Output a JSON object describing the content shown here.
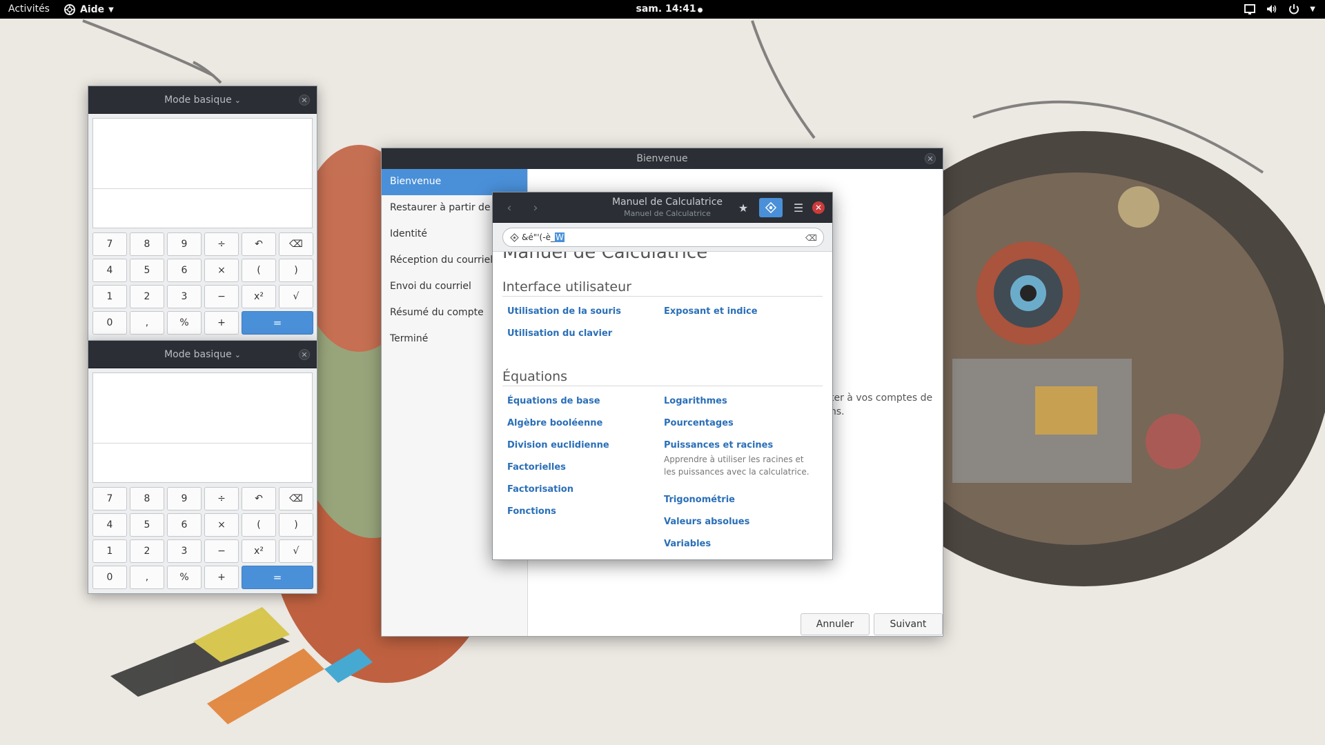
{
  "topbar": {
    "activities": "Activités",
    "app_menu": "Aide",
    "clock": "sam. 14:41"
  },
  "calculator_windows": [
    {
      "mode": "Mode basique",
      "keys": [
        "7",
        "8",
        "9",
        "÷",
        "↶",
        "⌫",
        "4",
        "5",
        "6",
        "×",
        "(",
        ")",
        "1",
        "2",
        "3",
        "−",
        "x²",
        "√",
        "0",
        ",",
        "%",
        "+",
        "="
      ]
    },
    {
      "mode": "Mode basique",
      "keys": [
        "7",
        "8",
        "9",
        "÷",
        "↶",
        "⌫",
        "4",
        "5",
        "6",
        "×",
        "(",
        ")",
        "1",
        "2",
        "3",
        "−",
        "x²",
        "√",
        "0",
        ",",
        "%",
        "+",
        "="
      ]
    }
  ],
  "welcome": {
    "title": "Bienvenue",
    "sidebar": [
      {
        "label": "Bienvenue",
        "active": true
      },
      {
        "label": "Restaurer à partir de l'a"
      },
      {
        "label": "Identité"
      },
      {
        "label": "Réception du courriel"
      },
      {
        "label": "Envoi du courriel"
      },
      {
        "label": "Résumé du compte"
      },
      {
        "label": "Terminé"
      }
    ],
    "partial_text_1": "ter à vos comptes de",
    "partial_text_2": "ns.",
    "cancel": "Annuler",
    "next": "Suivant"
  },
  "help": {
    "title": "Manuel de Calculatrice",
    "subtitle": "Manuel de Calculatrice",
    "search_text": "&é\"'(-è_",
    "search_selected": "W",
    "cut_heading": "Manuel de Calculatrice",
    "sections": [
      {
        "heading": "Interface utilisateur",
        "left": [
          "Utilisation de la souris",
          "Utilisation du clavier"
        ],
        "right": [
          "Exposant et indice"
        ]
      },
      {
        "heading": "Équations",
        "left": [
          "Équations de base",
          "Algèbre booléenne",
          "Division euclidienne",
          "Factorielles",
          "Factorisation",
          "Fonctions"
        ],
        "right": [
          "Logarithmes",
          "Pourcentages",
          "Puissances et racines",
          "Trigonométrie",
          "Valeurs absolues",
          "Variables"
        ],
        "right_desc": "Apprendre à utiliser les racines et les puissances avec la calculatrice."
      }
    ]
  },
  "colors": {
    "accent": "#4a90d9",
    "headerbar": "#2b2f35",
    "link": "#2a6fb8"
  }
}
